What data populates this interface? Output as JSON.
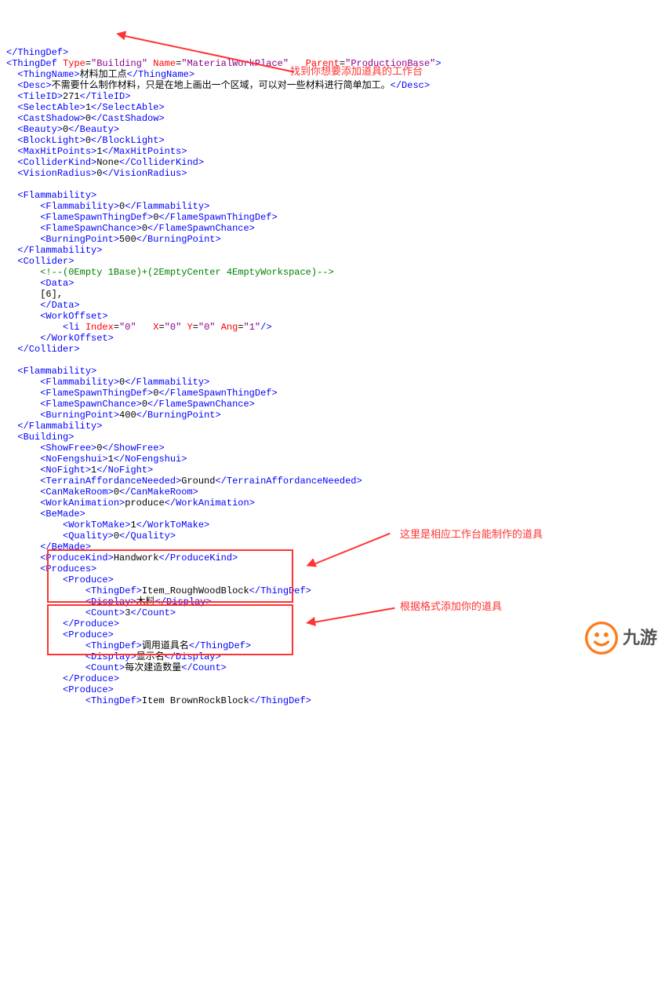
{
  "lines": {
    "l0": "</ThingDef>",
    "l1a": "<ThingDef",
    "l1_type_k": "Type",
    "l1_type_v": "\"Building\"",
    "l1_name_k": "Name",
    "l1_name_v": "\"MaterialWorkPlace\"",
    "l1_parent_k": "Parent",
    "l1_parent_v": "\"ProductionBase\"",
    "l2_open": "<ThingName>",
    "l2_txt": "材料加工点",
    "l2_close": "</ThingName>",
    "l3_open": "<Desc>",
    "l3_txt": "不需要什么制作材料，只是在地上画出一个区域，可以对一些材料进行简单加工。",
    "l3_close": "</Desc>",
    "l4_open": "<TileID>",
    "l4_txt": "271",
    "l4_close": "</TileID>",
    "l5_open": "<SelectAble>",
    "l5_txt": "1",
    "l5_close": "</SelectAble>",
    "l6_open": "<CastShadow>",
    "l6_txt": "0",
    "l6_close": "</CastShadow>",
    "l7_open": "<Beauty>",
    "l7_txt": "0",
    "l7_close": "</Beauty>",
    "l8_open": "<BlockLight>",
    "l8_txt": "0",
    "l8_close": "</BlockLight>",
    "l9_open": "<MaxHitPoints>",
    "l9_txt": "1",
    "l9_close": "</MaxHitPoints>",
    "l10_open": "<ColliderKind>",
    "l10_txt": "None",
    "l10_close": "</ColliderKind>",
    "l11_open": "<VisionRadius>",
    "l11_txt": "0",
    "l11_close": "</VisionRadius>",
    "flam_open": "<Flammability>",
    "flam_inner_open": "<Flammability>",
    "flam_inner_txt": "0",
    "flam_inner_close": "</Flammability>",
    "fst_open": "<FlameSpawnThingDef>",
    "fst_txt": "0",
    "fst_close": "</FlameSpawnThingDef>",
    "fsc_open": "<FlameSpawnChance>",
    "fsc_txt": "0",
    "fsc_close": "</FlameSpawnChance>",
    "bp_open": "<BurningPoint>",
    "bp_txt1": "500",
    "bp_txt2": "400",
    "bp_close": "</BurningPoint>",
    "flam_close": "</Flammability>",
    "coll_open": "<Collider>",
    "coll_cmt": "<!--(0Empty 1Base)+(2EmptyCenter 4EmptyWorkspace)-->",
    "data_open": "<Data>",
    "data_val": "[6],",
    "data_close": "</Data>",
    "wo_open": "<WorkOffset>",
    "li_open": "<li",
    "li_idx_k": "Index",
    "li_idx_v": "\"0\"",
    "li_x_k": "X",
    "li_x_v": "\"0\"",
    "li_y_k": "Y",
    "li_y_v": "\"0\"",
    "li_ang_k": "Ang",
    "li_ang_v": "\"1\"",
    "li_close": "/>",
    "wo_close": "</WorkOffset>",
    "coll_close": "</Collider>",
    "bld_open": "<Building>",
    "sf_open": "<ShowFree>",
    "sf_txt": "0",
    "sf_close": "</ShowFree>",
    "nf_open": "<NoFengshui>",
    "nf_txt": "1",
    "nf_close": "</NoFengshui>",
    "nfg_open": "<NoFight>",
    "nfg_txt": "1",
    "nfg_close": "</NoFight>",
    "tan_open": "<TerrainAffordanceNeeded>",
    "tan_txt": "Ground",
    "tan_close": "</TerrainAffordanceNeeded>",
    "cmr_open": "<CanMakeRoom>",
    "cmr_txt": "0",
    "cmr_close": "</CanMakeRoom>",
    "wa_open": "<WorkAnimation>",
    "wa_txt": "produce",
    "wa_close": "</WorkAnimation>",
    "bm_open": "<BeMade>",
    "wtm_open": "<WorkToMake>",
    "wtm_txt": "1",
    "wtm_close": "</WorkToMake>",
    "q_open": "<Quality>",
    "q_txt": "0",
    "q_close": "</Quality>",
    "bm_close": "</BeMade>",
    "pk_open": "<ProduceKind>",
    "pk_txt": "Handwork",
    "pk_close": "</ProduceKind>",
    "ps_open": "<Produces>",
    "p_open": "<Produce>",
    "td_open": "<ThingDef>",
    "td_txt1": "Item_RoughWoodBlock",
    "td_close": "</ThingDef>",
    "dsp_open": "<Display>",
    "dsp_txt1": "木料",
    "dsp_close": "</Display>",
    "cnt_open": "<Count>",
    "cnt_txt1": "3",
    "cnt_close": "</Count>",
    "p_close": "</Produce>",
    "td_txt2": "调用道具名",
    "dsp_txt2": "显示名",
    "cnt_txt2": "每次建造数量",
    "td_txt3": "Item BrownRockBlock"
  },
  "annotations": {
    "a1": "找到你想要添加道具的工作台",
    "a2": "这里是相应工作台能制作的道具",
    "a3": "根据格式添加你的道具"
  },
  "logo_text": "九游"
}
